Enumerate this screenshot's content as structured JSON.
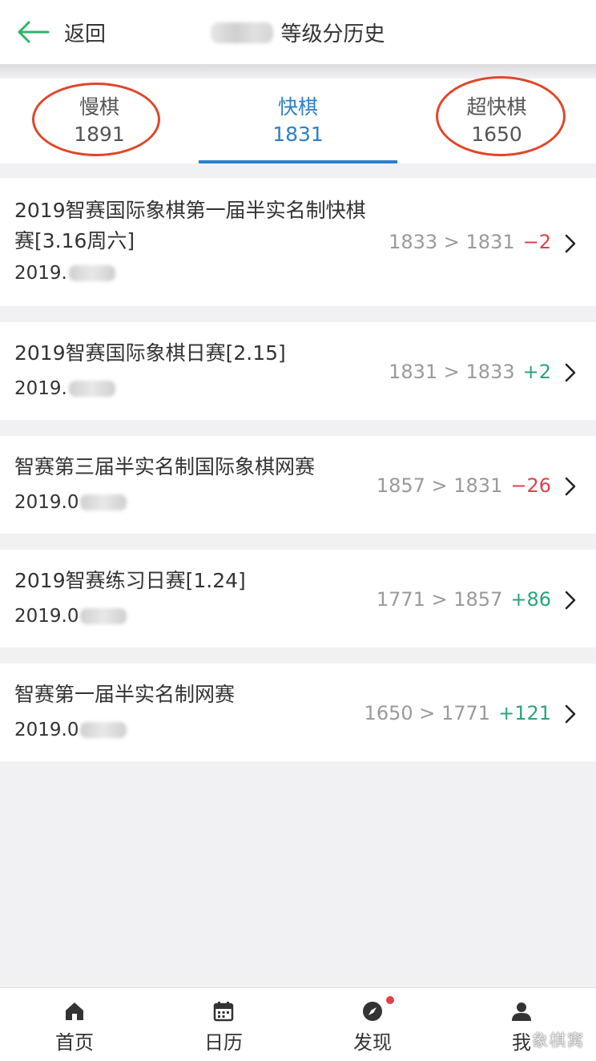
{
  "header": {
    "back_label": "返回",
    "title": "等级分历史"
  },
  "tabs": [
    {
      "label": "慢棋",
      "value": "1891",
      "active": false
    },
    {
      "label": "快棋",
      "value": "1831",
      "active": true
    },
    {
      "label": "超快棋",
      "value": "1650",
      "active": false
    }
  ],
  "records": [
    {
      "name": "2019智赛国际象棋第一届半实名制快棋赛[3.16周六]",
      "date": "2019.",
      "rating": "1833 > 1831",
      "delta": "−2",
      "delta_sign": "neg"
    },
    {
      "name": "2019智赛国际象棋日赛[2.15]",
      "date": "2019.",
      "rating": "1831 > 1833",
      "delta": "+2",
      "delta_sign": "pos"
    },
    {
      "name": "智赛第三届半实名制国际象棋网赛",
      "date": "2019.0",
      "rating": "1857 > 1831",
      "delta": "−26",
      "delta_sign": "neg"
    },
    {
      "name": "2019智赛练习日赛[1.24]",
      "date": "2019.0",
      "rating": "1771 > 1857",
      "delta": "+86",
      "delta_sign": "pos"
    },
    {
      "name": "智赛第一届半实名制网赛",
      "date": "2019.0",
      "rating": "1650 > 1771",
      "delta": "+121",
      "delta_sign": "pos"
    }
  ],
  "nav": [
    {
      "label": "首页",
      "icon": "home-icon"
    },
    {
      "label": "日历",
      "icon": "calendar-icon"
    },
    {
      "label": "发现",
      "icon": "compass-icon",
      "badge": true
    },
    {
      "label": "我",
      "icon": "user-icon"
    }
  ],
  "watermark": "象棋窝",
  "colors": {
    "accent": "#2a80c9",
    "back_arrow": "#2fb36b",
    "negative": "#e0414a",
    "positive": "#2aa57a",
    "annotation_circle": "#e0462a"
  }
}
